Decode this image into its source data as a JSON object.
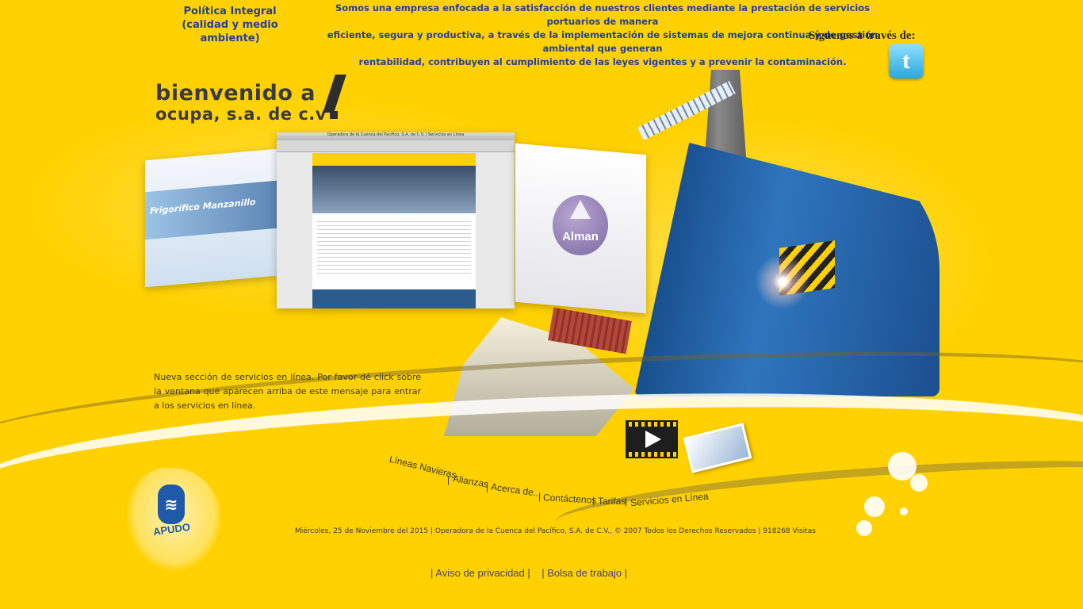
{
  "header": {
    "policy_title_line1": "Política Integral",
    "policy_title_line2": "(calidad y medio ambiente)",
    "policy_text_line1": "Somos una empresa enfocada a la satisfacción de nuestros clientes mediante la prestación de servicios portuarios de manera",
    "policy_text_line2": "eficiente, segura y productiva, a través de la implementación de sistemas de mejora continua y de gestión ambiental que generan",
    "policy_text_line3": "rentabilidad, contribuyen al cumplimiento de las leyes vigentes y a prevenir la contaminación.",
    "follow_label": "Síguenos a través de:",
    "twitter_glyph": "t"
  },
  "welcome": {
    "line1": "bienvenido a",
    "line2": "ocupa, s.a. de c.v"
  },
  "screens": {
    "left_brand": "Frigorífico Manzanillo",
    "center_title": "Operadora de la Cuenca del Pacífico, S.A. de C.V. | Servicios en Línea",
    "right_brand": "Alman"
  },
  "intro": {
    "text": "Nueva sección de servicios en línea. Por favor dé click sobre la ventana que aparecen arriba de este mensaje para entrar a los servicios en línea."
  },
  "nav": {
    "item1": "Líneas Navieras",
    "item2": "Alianzas",
    "item3": "Acerca de...",
    "item4": "Contáctenos",
    "item5": "Tarifas",
    "item6": "Servicios en Línea",
    "sep": "|"
  },
  "logo": {
    "glyph": "≋",
    "word": "APUDO"
  },
  "footer": {
    "info": "Miércoles, 25 de Noviembre del 2015 | Operadora de la Cuenca del Pacífico, S.A. de C.V., © 2007 Todos los Derechos Reservados | 918268 Visitas",
    "privacy": "| Aviso de privacidad |",
    "jobs": "| Bolsa de trabajo |"
  },
  "colors": {
    "background": "#ffd100",
    "policy_blue": "#1f3fa3",
    "link_purple": "#4b3b8c",
    "crane_blue": "#2f75bd"
  }
}
